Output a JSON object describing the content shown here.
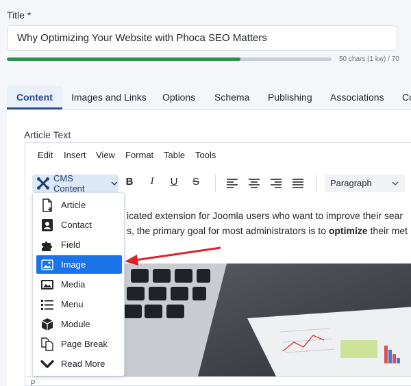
{
  "title_field": {
    "label": "Title *",
    "value": "Why Optimizing Your Website with Phoca SEO Matters",
    "char_count": "50 chars (1 kw) / 70",
    "progress": 0.72
  },
  "tabs": [
    {
      "label": "Content"
    },
    {
      "label": "Images and Links"
    },
    {
      "label": "Options"
    },
    {
      "label": "Schema"
    },
    {
      "label": "Publishing"
    },
    {
      "label": "Associations"
    },
    {
      "label": "Co"
    }
  ],
  "editor": {
    "label": "Article Text",
    "menubar": [
      "Edit",
      "Insert",
      "View",
      "Format",
      "Table",
      "Tools"
    ],
    "cms_button": "CMS Content",
    "format_select": "Paragraph",
    "body_line1": "icated extension for Joomla users who want to improve their sear",
    "body_line2_pre": "s, the primary goal for most administrators is to ",
    "body_line2_bold": "optimize",
    "body_line2_post": " their met",
    "path": "p"
  },
  "dropdown": {
    "items": [
      {
        "label": "Article",
        "icon": "article-add-icon"
      },
      {
        "label": "Contact",
        "icon": "contact-card-icon"
      },
      {
        "label": "Field",
        "icon": "puzzle-icon"
      },
      {
        "label": "Image",
        "icon": "image-icon"
      },
      {
        "label": "Media",
        "icon": "media-icon"
      },
      {
        "label": "Menu",
        "icon": "menu-list-icon"
      },
      {
        "label": "Module",
        "icon": "cube-icon"
      },
      {
        "label": "Page Break",
        "icon": "page-break-icon"
      },
      {
        "label": "Read More",
        "icon": "chevron-down-icon"
      }
    ],
    "active": "Image"
  },
  "colors": {
    "accent": "#1a73e8",
    "tab_active": "#2a4a8a",
    "progress": "#2f8f4e",
    "arrow": "#e0202a"
  }
}
